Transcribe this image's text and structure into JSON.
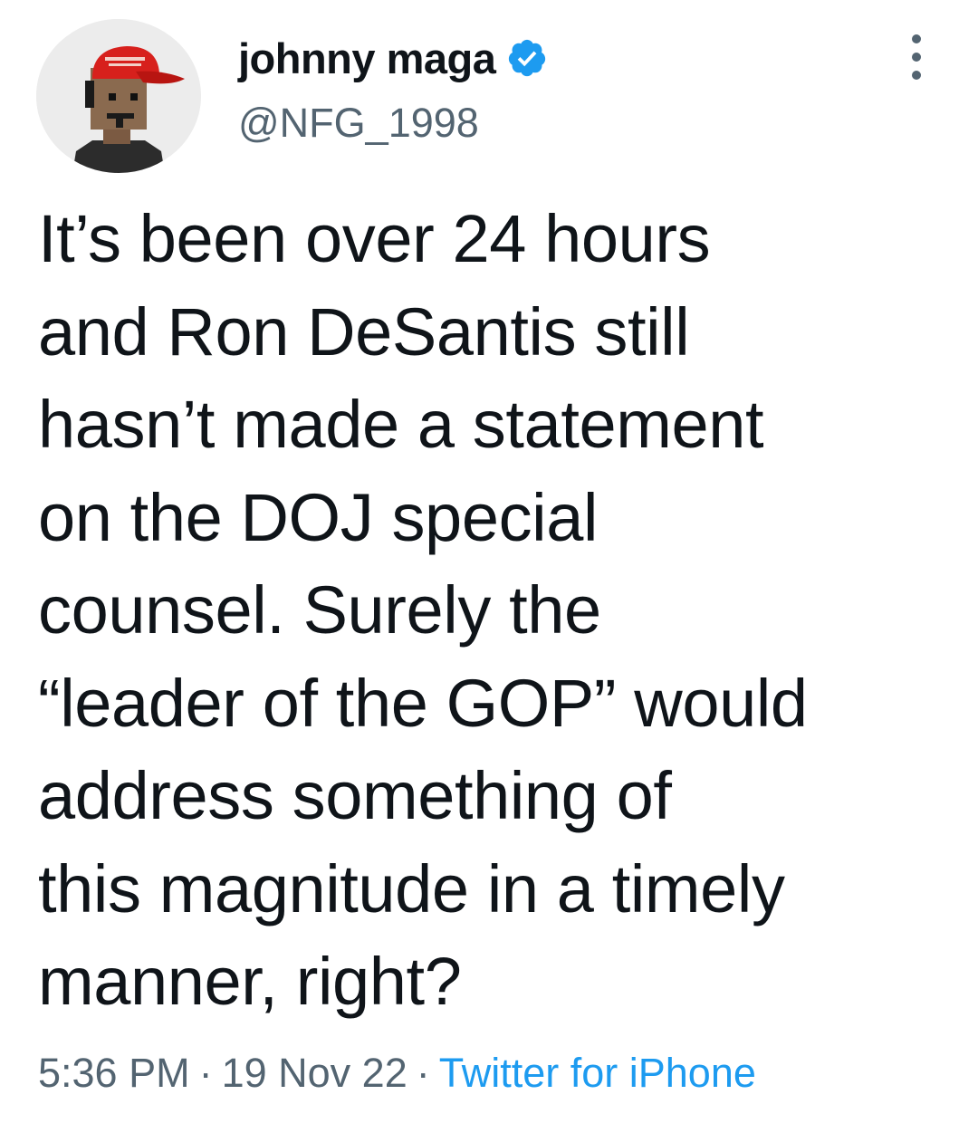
{
  "author": {
    "display_name": "johnny maga",
    "handle": "@NFG_1998",
    "verified": true,
    "verified_icon": "verified-badge-icon",
    "avatar_icon": "pixel-character-red-hat-avatar"
  },
  "more_icon": "more-vertical-icon",
  "tweet": {
    "lines": [
      "It’s been over 24 hours",
      "and Ron DeSantis still",
      "hasn’t made a statement",
      "on the DOJ special",
      "counsel. Surely the",
      "“leader of the GOP” would",
      "address something of",
      "this magnitude in a timely",
      "manner, right?"
    ]
  },
  "meta": {
    "time": "5:36 PM",
    "separator": "·",
    "date": "19 Nov 22",
    "source": "Twitter for iPhone"
  },
  "colors": {
    "text": "#0f1419",
    "secondary": "#536471",
    "link": "#1d9bf0",
    "verified": "#1d9bf0",
    "hat": "#d7201c"
  }
}
